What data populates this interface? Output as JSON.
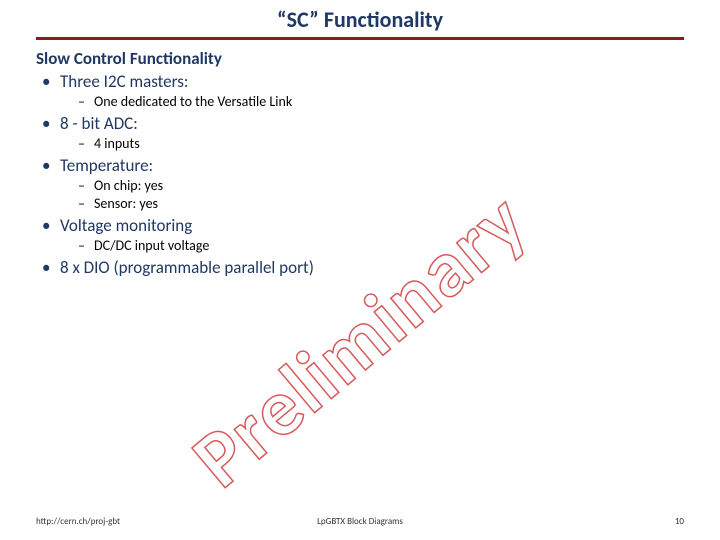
{
  "title": "“SC” Functionality",
  "heading": "Slow Control Functionality",
  "bullets": {
    "b0": {
      "label": "Three I2C masters:",
      "sub": [
        "One dedicated to the Versatile Link"
      ]
    },
    "b1": {
      "label": "8 - bit ADC:",
      "sub": [
        "4 inputs"
      ]
    },
    "b2": {
      "label": "Temperature:",
      "sub": [
        "On chip: yes",
        "Sensor: yes"
      ]
    },
    "b3": {
      "label": "Voltage monitoring",
      "sub": [
        "DC/DC input voltage"
      ]
    },
    "b4": {
      "label": "8 x DIO (programmable parallel port)",
      "sub": []
    }
  },
  "watermark": "Preliminary",
  "footer": {
    "left": "http://cern.ch/proj-gbt",
    "center": "LpGBTX Block Diagrams",
    "right": "10"
  }
}
